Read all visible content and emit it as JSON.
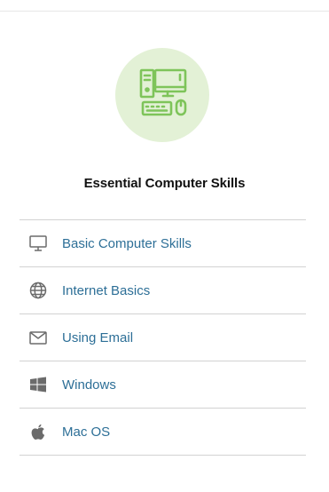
{
  "card": {
    "title": "Essential Computer Skills",
    "hero_icon": "computer-desktop-icon",
    "hero_bg_color": "#e3f1d6",
    "hero_icon_color": "#7ec45a"
  },
  "menu": {
    "link_color": "#2d6f97",
    "icon_color": "#6b6b6b",
    "items": [
      {
        "label": "Basic Computer Skills",
        "icon": "monitor-icon"
      },
      {
        "label": "Internet Basics",
        "icon": "globe-icon"
      },
      {
        "label": "Using Email",
        "icon": "envelope-icon"
      },
      {
        "label": "Windows",
        "icon": "windows-logo-icon"
      },
      {
        "label": "Mac OS",
        "icon": "apple-logo-icon"
      }
    ]
  }
}
